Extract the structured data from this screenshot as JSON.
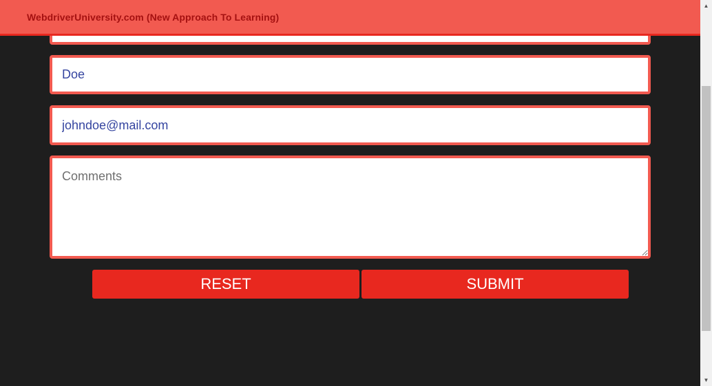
{
  "header": {
    "brand": "WebdriverUniversity.com (New Approach To Learning)"
  },
  "form": {
    "first_name_value": "",
    "last_name_value": "Doe",
    "email_value": "johndoe@mail.com",
    "comments_placeholder": "Comments",
    "reset_label": "RESET",
    "submit_label": "SUBMIT"
  },
  "scrollbar": {
    "up_arrow": "▲",
    "down_arrow": "▼"
  },
  "colors": {
    "header_bg": "#f25a50",
    "brand_text": "#a51111",
    "field_border": "#f25a50",
    "button_bg": "#e8281f",
    "page_bg": "#1e1e1e",
    "input_text": "#3545a0"
  }
}
